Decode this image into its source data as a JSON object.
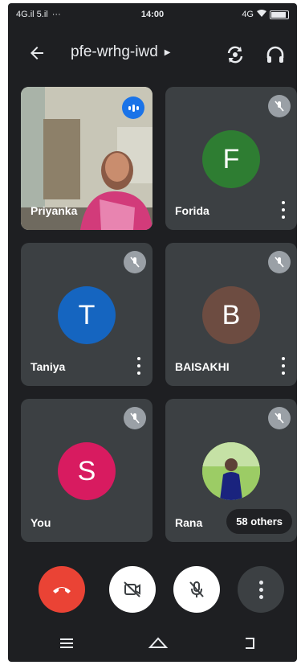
{
  "status_bar": {
    "left_text": "4G.il 5.il",
    "time": "14:00",
    "right_text": "4G"
  },
  "header": {
    "meeting_code": "pfe-wrhg-iwd",
    "back_icon": "arrow-left-icon",
    "switch_icon": "switch-camera-icon",
    "audio_icon": "headphones-icon"
  },
  "participants": [
    {
      "name": "Priyanka",
      "type": "video",
      "speaking": true
    },
    {
      "name": "Forida",
      "initial": "F",
      "color": "#2e7d32",
      "muted": true
    },
    {
      "name": "Taniya",
      "initial": "T",
      "color": "#1565c0",
      "muted": true
    },
    {
      "name": "BAISAKHI",
      "initial": "B",
      "color": "#6d4c41",
      "muted": true
    },
    {
      "name": "You",
      "initial": "S",
      "color": "#d81b60",
      "muted": true
    },
    {
      "name": "Rana",
      "type": "photo",
      "muted": true
    }
  ],
  "others_label": "58 others",
  "controls": {
    "end_call_color": "#ea4335",
    "icons": [
      "end-call-icon",
      "camera-off-icon",
      "mic-off-icon",
      "more-icon"
    ]
  },
  "nav": {
    "icons": [
      "recents-icon",
      "home-icon",
      "back-nav-icon"
    ]
  }
}
